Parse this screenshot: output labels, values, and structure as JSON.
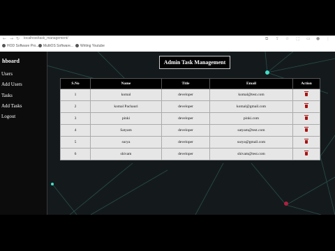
{
  "browser": {
    "url": "localhost/task_management/",
    "bookmarks": [
      {
        "label": "HOD Software Pro..."
      },
      {
        "label": "MultiOS Software..."
      },
      {
        "label": "Writing Youtube"
      }
    ]
  },
  "sidebar": {
    "title": "hboard",
    "items": [
      {
        "label": "Users"
      },
      {
        "label": "Add Users"
      },
      {
        "label": "Tasks"
      },
      {
        "label": "Add Tasks"
      },
      {
        "label": "Logout"
      }
    ]
  },
  "page": {
    "heading": "Admin Task Management"
  },
  "table": {
    "headers": [
      "S.No",
      "Name",
      "Title",
      "Email",
      "Action"
    ],
    "rows": [
      {
        "sno": "1",
        "name": "komal",
        "title": "developer",
        "email": "komal@test.com"
      },
      {
        "sno": "2",
        "name": "komal Pachauri",
        "title": "developer",
        "email": "komal@gmail.com"
      },
      {
        "sno": "3",
        "name": "pinki",
        "title": "developer",
        "email": "pinki.com"
      },
      {
        "sno": "4",
        "name": "Satyam",
        "title": "developer",
        "email": "satyam@test.com"
      },
      {
        "sno": "5",
        "name": "surya",
        "title": "developer",
        "email": "surya@gmail.com"
      },
      {
        "sno": "6",
        "name": "shivam",
        "title": "developer",
        "email": "shivam@test.com"
      }
    ]
  },
  "colors": {
    "delete_icon": "#a11111",
    "header_bg": "#000000",
    "row_bg": "#e6e6e6"
  }
}
